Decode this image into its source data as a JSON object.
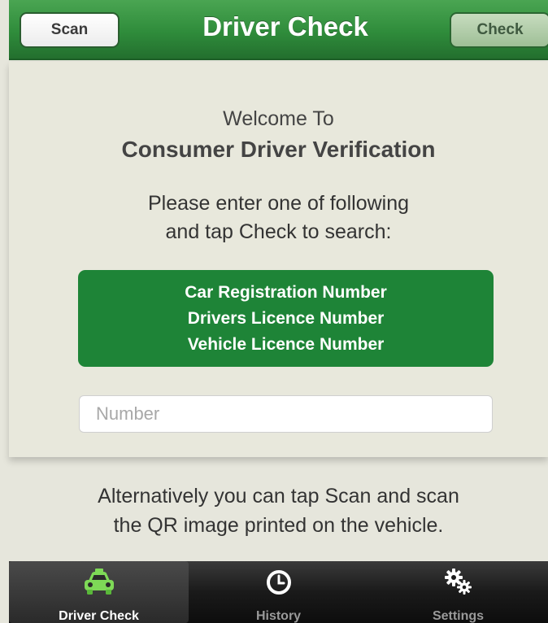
{
  "navbar": {
    "title": "Driver Check",
    "scan_label": "Scan",
    "check_label": "Check"
  },
  "main": {
    "welcome_line": "Welcome To",
    "welcome_title": "Consumer Driver Verification",
    "instructions": [
      "Please enter one of following",
      "and tap Check to search:"
    ],
    "options": [
      "Car Registration Number",
      "Drivers Licence Number",
      "Vehicle Licence Number"
    ],
    "number_input": {
      "placeholder": "Number",
      "value": ""
    }
  },
  "alternative": [
    "Alternatively you can tap Scan and scan",
    "the QR image printed on the vehicle."
  ],
  "tabbar": {
    "tabs": [
      {
        "label": "Driver Check",
        "icon": "taxi-car-icon",
        "active": true
      },
      {
        "label": "History",
        "icon": "clock-icon",
        "active": false
      },
      {
        "label": "Settings",
        "icon": "gears-icon",
        "active": false
      }
    ]
  },
  "colors": {
    "brand_green": "#2f8c3b",
    "options_box_green": "#1e8437",
    "background": "#e8e8dc",
    "tabbar_dark": "#1a1a1a"
  }
}
